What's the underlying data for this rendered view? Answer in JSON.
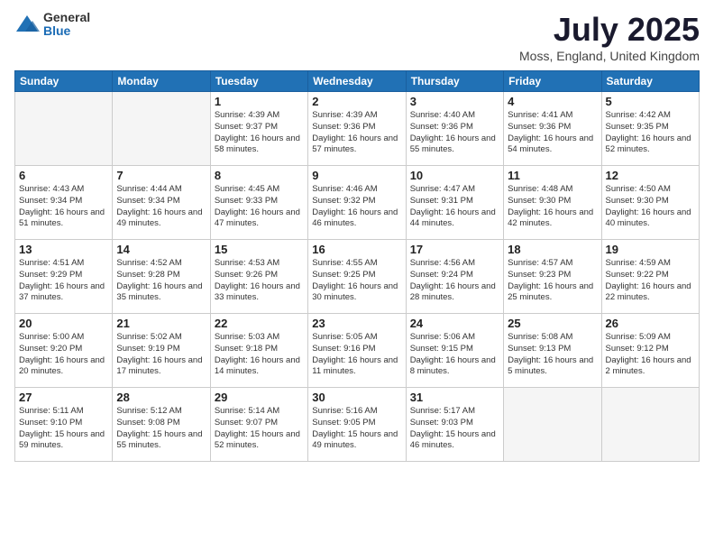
{
  "header": {
    "logo_general": "General",
    "logo_blue": "Blue",
    "title": "July 2025",
    "subtitle": "Moss, England, United Kingdom"
  },
  "days_of_week": [
    "Sunday",
    "Monday",
    "Tuesday",
    "Wednesday",
    "Thursday",
    "Friday",
    "Saturday"
  ],
  "weeks": [
    [
      {
        "day": "",
        "info": ""
      },
      {
        "day": "",
        "info": ""
      },
      {
        "day": "1",
        "info": "Sunrise: 4:39 AM\nSunset: 9:37 PM\nDaylight: 16 hours and 58 minutes."
      },
      {
        "day": "2",
        "info": "Sunrise: 4:39 AM\nSunset: 9:36 PM\nDaylight: 16 hours and 57 minutes."
      },
      {
        "day": "3",
        "info": "Sunrise: 4:40 AM\nSunset: 9:36 PM\nDaylight: 16 hours and 55 minutes."
      },
      {
        "day": "4",
        "info": "Sunrise: 4:41 AM\nSunset: 9:36 PM\nDaylight: 16 hours and 54 minutes."
      },
      {
        "day": "5",
        "info": "Sunrise: 4:42 AM\nSunset: 9:35 PM\nDaylight: 16 hours and 52 minutes."
      }
    ],
    [
      {
        "day": "6",
        "info": "Sunrise: 4:43 AM\nSunset: 9:34 PM\nDaylight: 16 hours and 51 minutes."
      },
      {
        "day": "7",
        "info": "Sunrise: 4:44 AM\nSunset: 9:34 PM\nDaylight: 16 hours and 49 minutes."
      },
      {
        "day": "8",
        "info": "Sunrise: 4:45 AM\nSunset: 9:33 PM\nDaylight: 16 hours and 47 minutes."
      },
      {
        "day": "9",
        "info": "Sunrise: 4:46 AM\nSunset: 9:32 PM\nDaylight: 16 hours and 46 minutes."
      },
      {
        "day": "10",
        "info": "Sunrise: 4:47 AM\nSunset: 9:31 PM\nDaylight: 16 hours and 44 minutes."
      },
      {
        "day": "11",
        "info": "Sunrise: 4:48 AM\nSunset: 9:30 PM\nDaylight: 16 hours and 42 minutes."
      },
      {
        "day": "12",
        "info": "Sunrise: 4:50 AM\nSunset: 9:30 PM\nDaylight: 16 hours and 40 minutes."
      }
    ],
    [
      {
        "day": "13",
        "info": "Sunrise: 4:51 AM\nSunset: 9:29 PM\nDaylight: 16 hours and 37 minutes."
      },
      {
        "day": "14",
        "info": "Sunrise: 4:52 AM\nSunset: 9:28 PM\nDaylight: 16 hours and 35 minutes."
      },
      {
        "day": "15",
        "info": "Sunrise: 4:53 AM\nSunset: 9:26 PM\nDaylight: 16 hours and 33 minutes."
      },
      {
        "day": "16",
        "info": "Sunrise: 4:55 AM\nSunset: 9:25 PM\nDaylight: 16 hours and 30 minutes."
      },
      {
        "day": "17",
        "info": "Sunrise: 4:56 AM\nSunset: 9:24 PM\nDaylight: 16 hours and 28 minutes."
      },
      {
        "day": "18",
        "info": "Sunrise: 4:57 AM\nSunset: 9:23 PM\nDaylight: 16 hours and 25 minutes."
      },
      {
        "day": "19",
        "info": "Sunrise: 4:59 AM\nSunset: 9:22 PM\nDaylight: 16 hours and 22 minutes."
      }
    ],
    [
      {
        "day": "20",
        "info": "Sunrise: 5:00 AM\nSunset: 9:20 PM\nDaylight: 16 hours and 20 minutes."
      },
      {
        "day": "21",
        "info": "Sunrise: 5:02 AM\nSunset: 9:19 PM\nDaylight: 16 hours and 17 minutes."
      },
      {
        "day": "22",
        "info": "Sunrise: 5:03 AM\nSunset: 9:18 PM\nDaylight: 16 hours and 14 minutes."
      },
      {
        "day": "23",
        "info": "Sunrise: 5:05 AM\nSunset: 9:16 PM\nDaylight: 16 hours and 11 minutes."
      },
      {
        "day": "24",
        "info": "Sunrise: 5:06 AM\nSunset: 9:15 PM\nDaylight: 16 hours and 8 minutes."
      },
      {
        "day": "25",
        "info": "Sunrise: 5:08 AM\nSunset: 9:13 PM\nDaylight: 16 hours and 5 minutes."
      },
      {
        "day": "26",
        "info": "Sunrise: 5:09 AM\nSunset: 9:12 PM\nDaylight: 16 hours and 2 minutes."
      }
    ],
    [
      {
        "day": "27",
        "info": "Sunrise: 5:11 AM\nSunset: 9:10 PM\nDaylight: 15 hours and 59 minutes."
      },
      {
        "day": "28",
        "info": "Sunrise: 5:12 AM\nSunset: 9:08 PM\nDaylight: 15 hours and 55 minutes."
      },
      {
        "day": "29",
        "info": "Sunrise: 5:14 AM\nSunset: 9:07 PM\nDaylight: 15 hours and 52 minutes."
      },
      {
        "day": "30",
        "info": "Sunrise: 5:16 AM\nSunset: 9:05 PM\nDaylight: 15 hours and 49 minutes."
      },
      {
        "day": "31",
        "info": "Sunrise: 5:17 AM\nSunset: 9:03 PM\nDaylight: 15 hours and 46 minutes."
      },
      {
        "day": "",
        "info": ""
      },
      {
        "day": "",
        "info": ""
      }
    ]
  ]
}
